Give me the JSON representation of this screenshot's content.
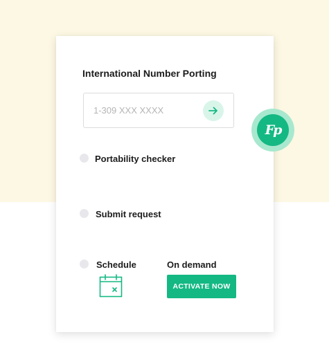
{
  "porting": {
    "title": "International Number Porting",
    "phone_placeholder": "1-309 XXX XXXX"
  },
  "logo": {
    "text": "Fp"
  },
  "steps": [
    {
      "label": "Portability checker"
    },
    {
      "label": "Submit request"
    },
    {
      "label": "Schedule"
    }
  ],
  "schedule": {
    "on_demand_label": "On demand",
    "activate_label": "ACTIVATE NOW"
  },
  "colors": {
    "accent": "#14b883",
    "accent_light": "#d9f5ea",
    "background_top": "#fdf8e3"
  },
  "icons": {
    "go": "arrow-right-icon",
    "calendar": "calendar-cancel-icon"
  }
}
